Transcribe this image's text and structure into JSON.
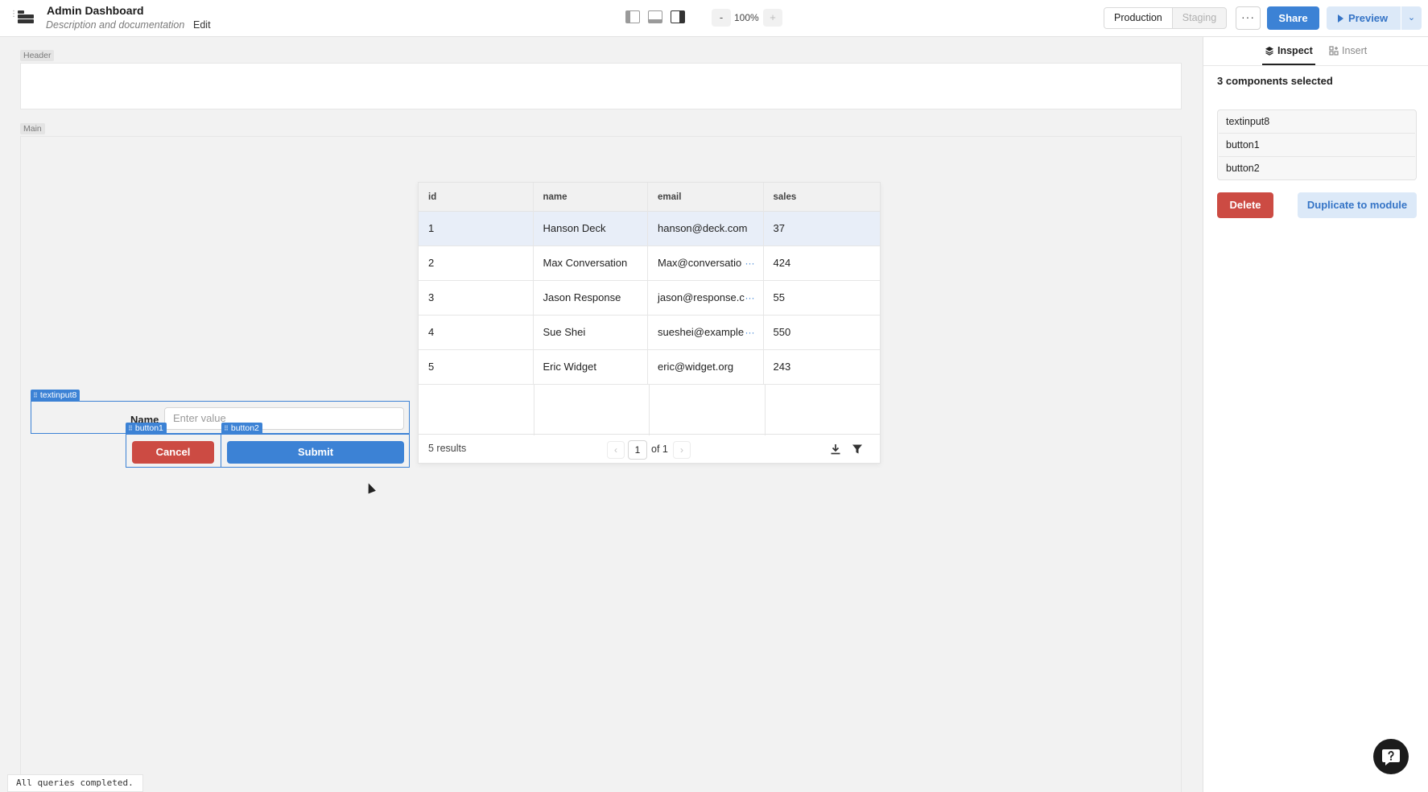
{
  "app": {
    "title": "Admin Dashboard",
    "description": "Description and documentation",
    "edit_label": "Edit"
  },
  "toolbar": {
    "zoom_minus": "-",
    "zoom_level": "100%",
    "zoom_plus": "+",
    "environments": [
      "Production",
      "Staging"
    ],
    "active_environment": "Production",
    "more_label": "···",
    "share_label": "Share",
    "preview_label": "Preview",
    "preview_caret": "⌄"
  },
  "canvas": {
    "header_label": "Header",
    "main_label": "Main"
  },
  "table": {
    "columns": [
      "id",
      "name",
      "email",
      "sales"
    ],
    "rows": [
      {
        "id": "1",
        "name": "Hanson Deck",
        "email": "hanson@deck.com",
        "sales": "37",
        "truncated": false
      },
      {
        "id": "2",
        "name": "Max Conversation",
        "email": "Max@conversatio",
        "sales": "424",
        "truncated": true
      },
      {
        "id": "3",
        "name": "Jason Response",
        "email": "jason@response.c",
        "sales": "55",
        "truncated": true
      },
      {
        "id": "4",
        "name": "Sue Shei",
        "email": "sueshei@example",
        "sales": "550",
        "truncated": true
      },
      {
        "id": "5",
        "name": "Eric Widget",
        "email": "eric@widget.org",
        "sales": "243",
        "truncated": false
      }
    ],
    "selected_row": 0,
    "results_label": "5 results",
    "page_current": "1",
    "page_total_label": "of 1",
    "ellipsis": "···"
  },
  "form": {
    "textinput_tag": "textinput8",
    "button1_tag": "button1",
    "button2_tag": "button2",
    "name_label": "Name",
    "input_placeholder": "Enter value",
    "cancel_label": "Cancel",
    "submit_label": "Submit"
  },
  "status": {
    "text": "All queries completed."
  },
  "panel": {
    "tabs": [
      "Inspect",
      "Insert"
    ],
    "active_tab": "Inspect",
    "heading": "3 components selected",
    "selected_components": [
      "textinput8",
      "button1",
      "button2"
    ],
    "delete_label": "Delete",
    "duplicate_label": "Duplicate to module"
  },
  "colors": {
    "accent": "#3c82d5",
    "danger": "#cc4b43",
    "accent_soft": "#dce9f8"
  }
}
